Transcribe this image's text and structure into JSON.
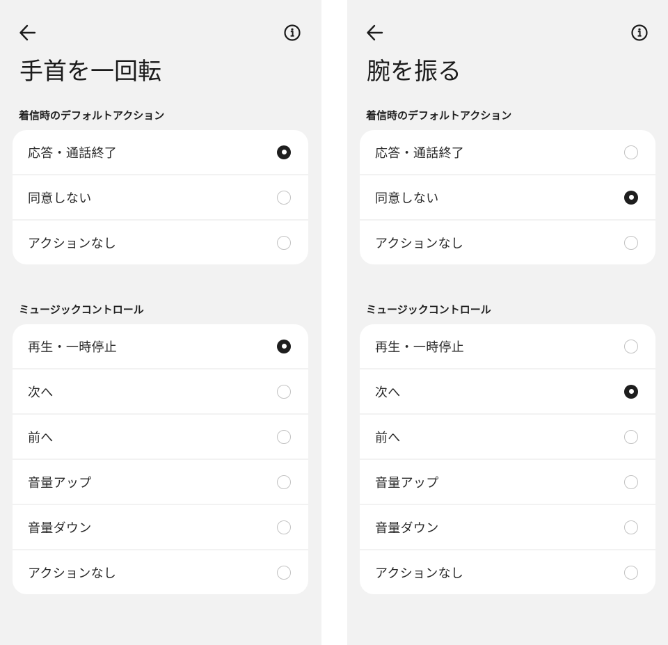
{
  "screens": [
    {
      "title": "手首を一回転",
      "sections": [
        {
          "header": "着信時のデフォルトアクション",
          "options": [
            {
              "label": "応答・通話終了",
              "selected": true
            },
            {
              "label": "同意しない",
              "selected": false
            },
            {
              "label": "アクションなし",
              "selected": false
            }
          ]
        },
        {
          "header": "ミュージックコントロール",
          "options": [
            {
              "label": "再生・一時停止",
              "selected": true
            },
            {
              "label": "次へ",
              "selected": false
            },
            {
              "label": "前へ",
              "selected": false
            },
            {
              "label": "音量アップ",
              "selected": false
            },
            {
              "label": "音量ダウン",
              "selected": false
            },
            {
              "label": "アクションなし",
              "selected": false
            }
          ]
        }
      ]
    },
    {
      "title": "腕を振る",
      "sections": [
        {
          "header": "着信時のデフォルトアクション",
          "options": [
            {
              "label": "応答・通話終了",
              "selected": false
            },
            {
              "label": "同意しない",
              "selected": true
            },
            {
              "label": "アクションなし",
              "selected": false
            }
          ]
        },
        {
          "header": "ミュージックコントロール",
          "options": [
            {
              "label": "再生・一時停止",
              "selected": false
            },
            {
              "label": "次へ",
              "selected": true
            },
            {
              "label": "前へ",
              "selected": false
            },
            {
              "label": "音量アップ",
              "selected": false
            },
            {
              "label": "音量ダウン",
              "selected": false
            },
            {
              "label": "アクションなし",
              "selected": false
            }
          ]
        }
      ]
    }
  ],
  "icons": {
    "back": "arrow-back-icon",
    "info": "info-icon"
  },
  "colors": {
    "background": "#f2f2f2",
    "card": "#ffffff",
    "radio_selected": "#1e1e1e",
    "radio_unselected_border": "#c2c2c2"
  }
}
